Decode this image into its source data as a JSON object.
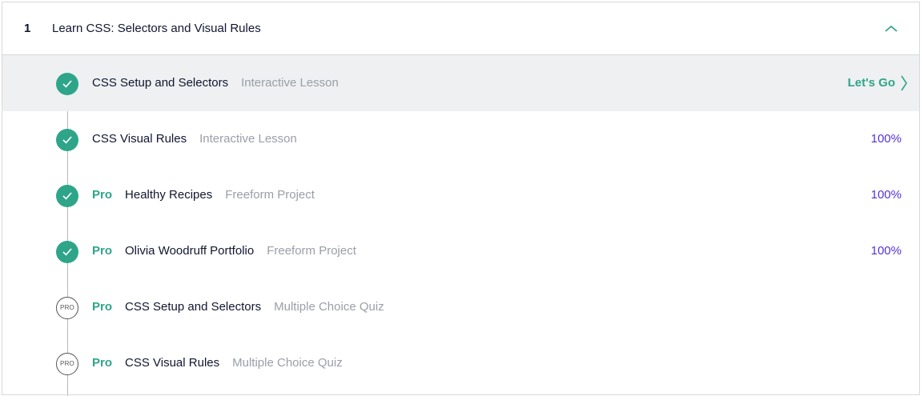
{
  "module": {
    "number": "1",
    "title": "Learn CSS: Selectors and Visual Rules",
    "collapse_icon": "chevron-up-icon"
  },
  "colors": {
    "accent_green": "#2ea589",
    "percent_purple": "#5533d4",
    "muted_text": "#9a9ea7",
    "active_row_bg": "#eef0f2"
  },
  "lessons": [
    {
      "status": "complete",
      "pro": "",
      "title": "CSS Setup and Selectors",
      "type": "Interactive Lesson",
      "action": "Let's Go",
      "active": true
    },
    {
      "status": "complete",
      "pro": "",
      "title": "CSS Visual Rules",
      "type": "Interactive Lesson",
      "action": "100%"
    },
    {
      "status": "complete",
      "pro": "Pro",
      "title": "Healthy Recipes",
      "type": "Freeform Project",
      "action": "100%"
    },
    {
      "status": "complete",
      "pro": "Pro",
      "title": "Olivia Woodruff Portfolio",
      "type": "Freeform Project",
      "action": "100%"
    },
    {
      "status": "locked",
      "badge": "PRO",
      "pro": "Pro",
      "title": "CSS Setup and Selectors",
      "type": "Multiple Choice Quiz",
      "action": ""
    },
    {
      "status": "locked",
      "badge": "PRO",
      "pro": "Pro",
      "title": "CSS Visual Rules",
      "type": "Multiple Choice Quiz",
      "action": ""
    }
  ]
}
